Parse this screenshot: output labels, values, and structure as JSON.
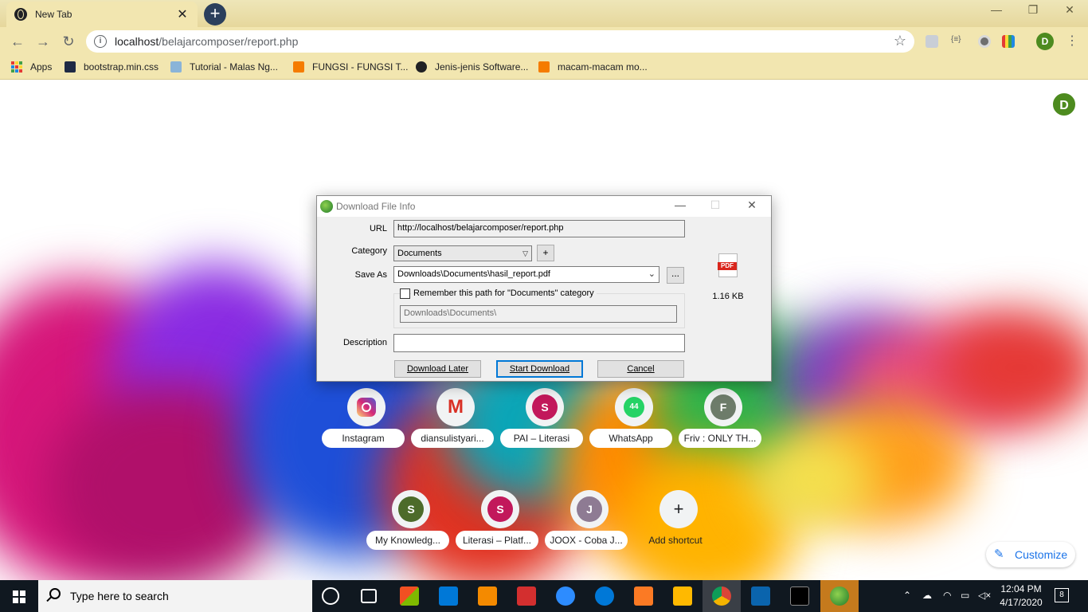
{
  "browser": {
    "tab_title": "New Tab",
    "tab_close": "✕",
    "new_tab": "+",
    "window_controls": {
      "minimize": "—",
      "maximize": "❐",
      "close": "✕"
    },
    "url_host": "localhost",
    "url_path": "/belajarcomposer/report.php",
    "profile_initial": "D",
    "bookmarks": [
      {
        "label": "Apps"
      },
      {
        "label": "bootstrap.min.css",
        "color": "#1f2a44"
      },
      {
        "label": "Tutorial - Malas Ng...",
        "color": "#8ab4d8"
      },
      {
        "label": "FUNGSI - FUNGSI T...",
        "color": "#f57c00"
      },
      {
        "label": "Jenis-jenis Software...",
        "color": "#202124"
      },
      {
        "label": "macam-macam mo...",
        "color": "#f57c00"
      }
    ]
  },
  "ntp": {
    "avatar_initial": "D",
    "customize_label": "Customize",
    "shortcuts": [
      {
        "label": "Instagram",
        "icon": "instagram-icon"
      },
      {
        "label": "diansulistyari...",
        "icon": "gmail-icon"
      },
      {
        "label": "PAI – Literasi",
        "letter": "S",
        "color": "#c2185b"
      },
      {
        "label": "WhatsApp",
        "icon": "whatsapp-icon",
        "badge": "44"
      },
      {
        "label": "Friv : ONLY TH...",
        "letter": "F",
        "color": "#6d7c6a"
      },
      {
        "label": "My Knowledg...",
        "letter": "S",
        "color": "#4d6b2a"
      },
      {
        "label": "Literasi – Platf...",
        "letter": "S",
        "color": "#c2185b"
      },
      {
        "label": "JOOX - Coba J...",
        "letter": "J",
        "color": "#8e7b93"
      },
      {
        "label": "Add shortcut",
        "icon": "plus-icon",
        "letter": "+"
      }
    ]
  },
  "dialog": {
    "title": "Download File Info",
    "url_label": "URL",
    "url_value": "http://localhost/belajarcomposer/report.php",
    "category_label": "Category",
    "category_value": "Documents",
    "add_category": "+",
    "save_as_label": "Save As",
    "save_as_value": "Downloads\\Documents\\hasil_report.pdf",
    "browse": "...",
    "remember_label": "Remember this path for \"Documents\" category",
    "remember_path": "Downloads\\Documents\\",
    "description_label": "Description",
    "description_value": "",
    "file_type": "PDF",
    "file_size": "1.16  KB",
    "buttons": {
      "later": "Download Later",
      "start": "Start Download",
      "cancel": "Cancel"
    }
  },
  "taskbar": {
    "search_placeholder": "Type here to search",
    "time": "12:04 PM",
    "date": "4/17/2020",
    "notification_count": "8"
  }
}
